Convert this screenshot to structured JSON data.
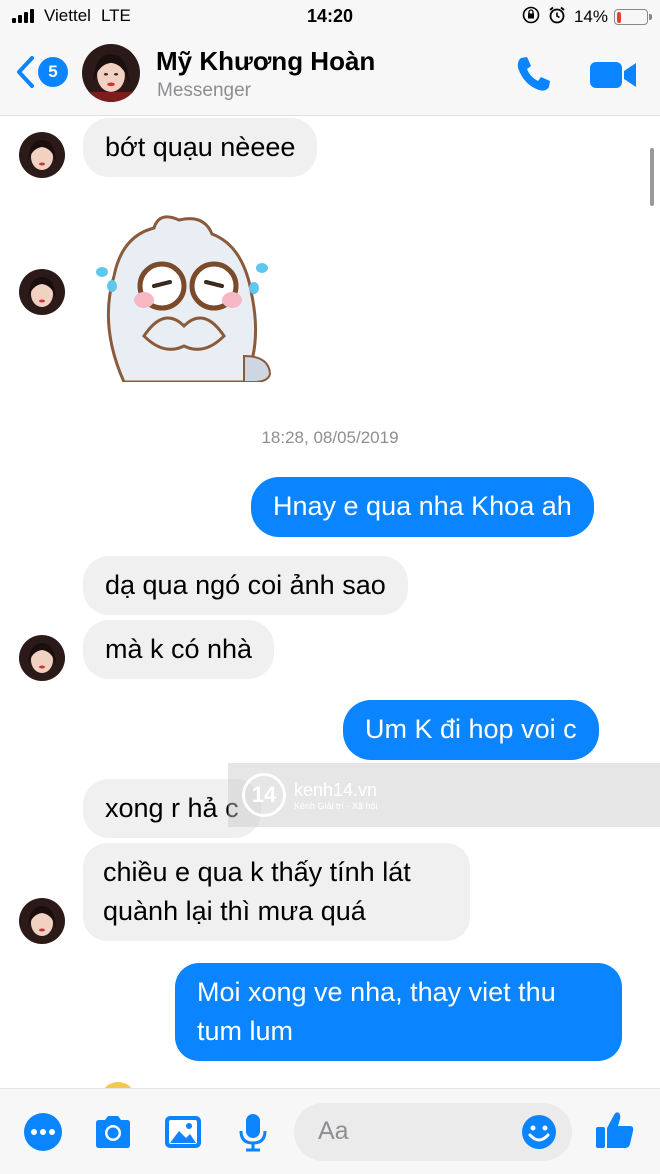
{
  "status_bar": {
    "carrier": "Viettel",
    "network": "LTE",
    "time": "14:20",
    "battery": "14%",
    "battery_level": 0.14
  },
  "header": {
    "back_count": "5",
    "name": "Mỹ Khương Hoàn",
    "subtitle": "Messenger"
  },
  "messages": [
    {
      "direction": "in",
      "text": "bớt quạu nèeee"
    },
    {
      "direction": "in",
      "type": "sticker",
      "sticker": "crying-bear-sticker"
    },
    {
      "type": "timestamp",
      "text": "18:28, 08/05/2019"
    },
    {
      "direction": "out",
      "text": "Hnay e qua nha Khoa ah"
    },
    {
      "direction": "in",
      "text": "dạ qua ngó coi ảnh sao"
    },
    {
      "direction": "in",
      "text": "mà k có nhà"
    },
    {
      "direction": "out",
      "text": "Um K đi hop voi c"
    },
    {
      "direction": "in",
      "text": "xong r hả c"
    },
    {
      "direction": "in",
      "lines": [
        "chiều e qua k thấy tính lát",
        "quành lại thì mưa quá"
      ]
    },
    {
      "direction": "out",
      "lines": [
        "Moi xong ve nha, thay viet thu",
        "tum lum"
      ]
    }
  ],
  "watermark": {
    "logo": "14",
    "brand": "kenh14.vn",
    "tagline": "Kênh Giải trí - Xã hội"
  },
  "composer": {
    "placeholder": "Aa",
    "icons": [
      "more-icon",
      "camera-icon",
      "gallery-icon",
      "microphone-icon",
      "emoji-icon",
      "thumbs-up-icon"
    ]
  },
  "colors": {
    "accent": "#0a84ff",
    "incoming_bubble": "#f0f0f0",
    "battery_low": "#e8402f"
  }
}
